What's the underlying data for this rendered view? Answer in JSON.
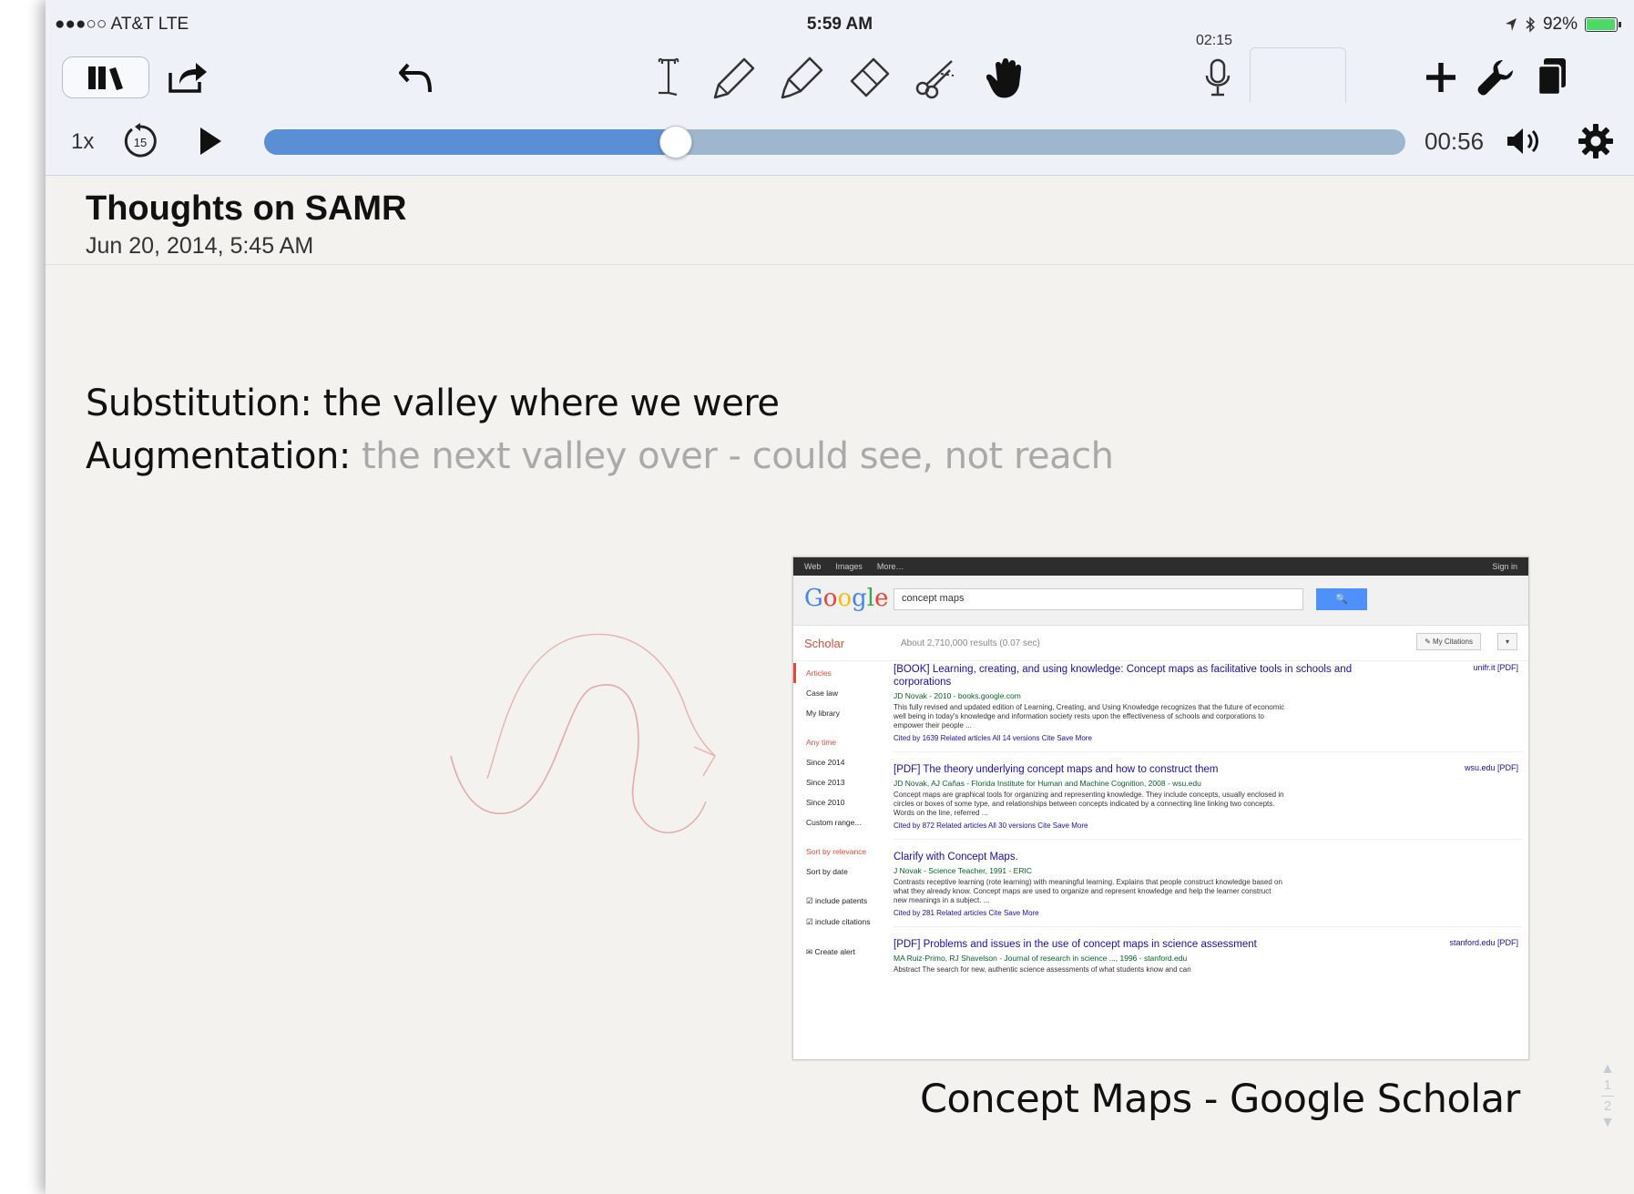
{
  "status_bar": {
    "carrier": "●●●○○ AT&T  LTE",
    "time": "5:59 AM",
    "battery_text": "92%",
    "battery_level": 0.92
  },
  "toolbar": {
    "icons": [
      "library-icon",
      "share-icon",
      "undo-icon",
      "text-tool-icon",
      "pen-icon",
      "highlighter-icon",
      "eraser-icon",
      "scissors-icon",
      "hand-icon",
      "microphone-icon",
      "chevron-up-icon",
      "plus-icon",
      "wrench-icon",
      "pages-icon"
    ],
    "recording_timer": "02:15"
  },
  "playback": {
    "speed": "1x",
    "elapsed": "00:56",
    "progress": 0.36,
    "icons": [
      "skip-back-15-icon",
      "play-icon",
      "volume-icon",
      "gear-icon"
    ]
  },
  "note": {
    "title": "Thoughts on SAMR",
    "date": "Jun 20, 2014, 5:45 AM",
    "line1": "Substitution: the valley where we were",
    "line2_label": "Augmentation:",
    "line2_text": " the next valley over - could see, not reach"
  },
  "screenshot": {
    "topbar": [
      "Web",
      "Images",
      "More…"
    ],
    "signin": "Sign in",
    "logo": "Google",
    "query": "concept maps",
    "search_button": "🔍",
    "scholar": "Scholar",
    "results_count": "About 2,710,000 results (0.07 sec)",
    "my_citations": "✎ My Citations",
    "more": "▾",
    "sidebar": {
      "articles": "Articles",
      "case_law": "Case law",
      "my_library": "My library",
      "any_time": "Any time",
      "since_2014": "Since 2014",
      "since_2013": "Since 2013",
      "since_2010": "Since 2010",
      "custom_range": "Custom range...",
      "sort_relevance": "Sort by relevance",
      "sort_date": "Sort by date",
      "include_patents": "☑ include patents",
      "include_citations": "☑ include citations",
      "create_alert": "✉ Create alert"
    },
    "results": [
      {
        "title": "[BOOK] Learning, creating, and using knowledge: Concept maps as facilitative tools in schools and corporations",
        "source": "unifr.it [PDF]",
        "authors": "JD Novak - 2010 - books.google.com",
        "snippet": "This fully revised and updated edition of Learning, Creating, and Using Knowledge recognizes that the future of economic well being in today's knowledge and information society rests upon the effectiveness of schools and corporations to empower their people ...",
        "links": "Cited by 1639   Related articles   All 14 versions   Cite   Save   More"
      },
      {
        "title": "[PDF] The theory underlying concept maps and how to construct them",
        "source": "wsu.edu [PDF]",
        "authors": "JD Novak, AJ Cañas - Florida Institute for Human and Machine Cognition, 2008 - wsu.edu",
        "snippet": "Concept maps are graphical tools for organizing and representing knowledge. They include concepts, usually enclosed in circles or boxes of some type, and relationships between concepts indicated by a connecting line linking two concepts. Words on the line, referred ...",
        "links": "Cited by 872   Related articles   All 30 versions   Cite   Save   More"
      },
      {
        "title": "Clarify with Concept Maps.",
        "source": "",
        "authors": "J Novak - Science Teacher, 1991 - ERIC",
        "snippet": "Contrasts receptive learning (rote learning) with meaningful learning. Explains that people construct knowledge based on what they already know. Concept maps are used to organize and represent knowledge and help the learner construct new meanings in a subject. ...",
        "links": "Cited by 281   Related articles   Cite   Save   More"
      },
      {
        "title": "[PDF] Problems and issues in the use of concept maps in science assessment",
        "source": "stanford.edu [PDF]",
        "authors": "MA Ruiz-Primo, RJ Shavelson - Journal of research in science ..., 1996 - stanford.edu",
        "snippet": "Abstract The search for new, authentic science assessments of what students know and can",
        "links": ""
      }
    ]
  },
  "caption": "Concept Maps - Google Scholar",
  "pager": {
    "current": "1",
    "total": "2"
  },
  "colors": {
    "progress_fill": "#5a8fd3",
    "progress_track": "#9fb6cf",
    "sketch_stroke": "#e6a3a3",
    "gray_text": "#a9a9a9"
  }
}
